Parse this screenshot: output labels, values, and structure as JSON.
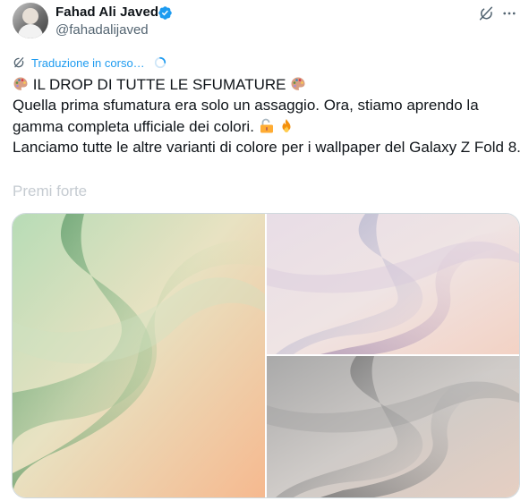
{
  "author": {
    "display_name": "Fahad Ali Javed",
    "handle": "@fahadalijaved",
    "verified": true,
    "avatar_icon": "avatar"
  },
  "header_actions": {
    "grok_icon": "grok-icon",
    "more_icon": "more-icon"
  },
  "translation": {
    "label": "Traduzione in corso…",
    "icon": "translate-icon",
    "status_icon": "loading-spinner"
  },
  "tweet": {
    "line1": "IL DROP DI TUTTE LE SFUMATURE",
    "line1_emoji": "🎨",
    "para2": "Quella prima sfumatura era solo un assaggio. Ora, stiamo aprendo la gamma completa ufficiale dei colori.",
    "para2_emojis": [
      "🔓",
      "🔥"
    ],
    "para3": "Lanciamo tutte le altre varianti di colore per i wallpaper del Galaxy Z Fold 8.",
    "show_more": "Premi forte"
  },
  "media": [
    {
      "name": "wallpaper-green",
      "colors": [
        "#a9d3ac",
        "#5f9b6b",
        "#f3c3a0"
      ]
    },
    {
      "name": "wallpaper-lavender",
      "colors": [
        "#e9dde4",
        "#a89bb8",
        "#f3d3c4"
      ]
    },
    {
      "name": "wallpaper-gray",
      "colors": [
        "#b9b9b9",
        "#5f5f5f",
        "#e2ccc0"
      ]
    }
  ],
  "colors": {
    "accent": "#1d9bf0",
    "text": "#0f1419",
    "secondary": "#536471"
  }
}
